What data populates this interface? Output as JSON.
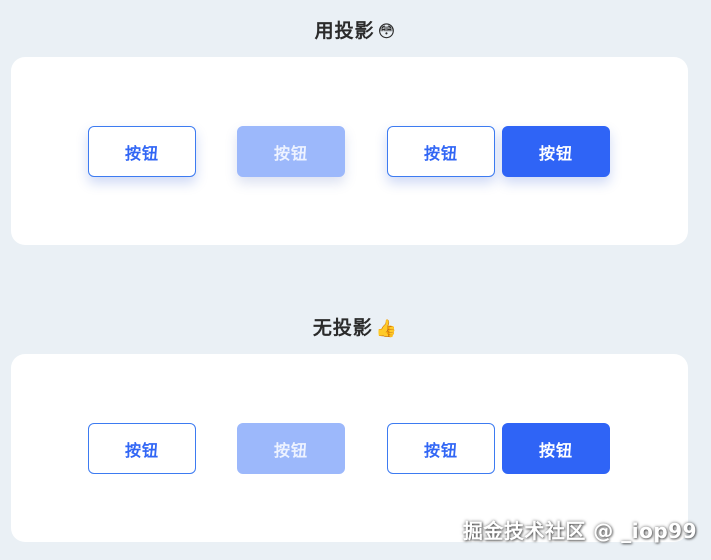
{
  "sections": [
    {
      "title": "用投影",
      "emoji": "😳"
    },
    {
      "title": "无投影",
      "emoji": "👍"
    }
  ],
  "buttons": {
    "label": "按钮"
  },
  "watermark": "掘金技术社区 @ _iop99",
  "colors": {
    "background": "#eaf0f5",
    "card": "#ffffff",
    "primary": "#2f64f6",
    "primary_light": "#9cb8fb",
    "outline_border": "#3d7bf1"
  }
}
